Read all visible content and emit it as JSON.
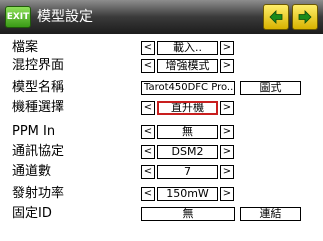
{
  "header": {
    "exit_label": "EXIT",
    "title": "模型設定",
    "prev_icon": "arrow-left-icon",
    "next_icon": "arrow-right-icon"
  },
  "arrows": {
    "left": "<",
    "right": ">"
  },
  "rows": {
    "file": {
      "label": "檔案",
      "value": "載入.."
    },
    "mix_ui": {
      "label": "混控界面",
      "value": "增強模式"
    },
    "model_name": {
      "label": "模型名稱",
      "value": "Tarot450DFC Pro..",
      "button": "圖式"
    },
    "model_type": {
      "label": "機種選擇",
      "value": "直升機"
    },
    "ppm_in": {
      "label": "PPM In",
      "value": "無"
    },
    "protocol": {
      "label": "通訊協定",
      "value": "DSM2"
    },
    "channels": {
      "label": "通道數",
      "value": "7"
    },
    "tx_power": {
      "label": "發射功率",
      "value": "150mW"
    },
    "fixed_id": {
      "label": "固定ID",
      "value": "無",
      "button": "連結"
    }
  },
  "colors": {
    "exit_button": "#3a9a16",
    "nav_button": "#ffd800",
    "titlebar": "#2a2a2a",
    "selected_border": "#c81e1e"
  }
}
